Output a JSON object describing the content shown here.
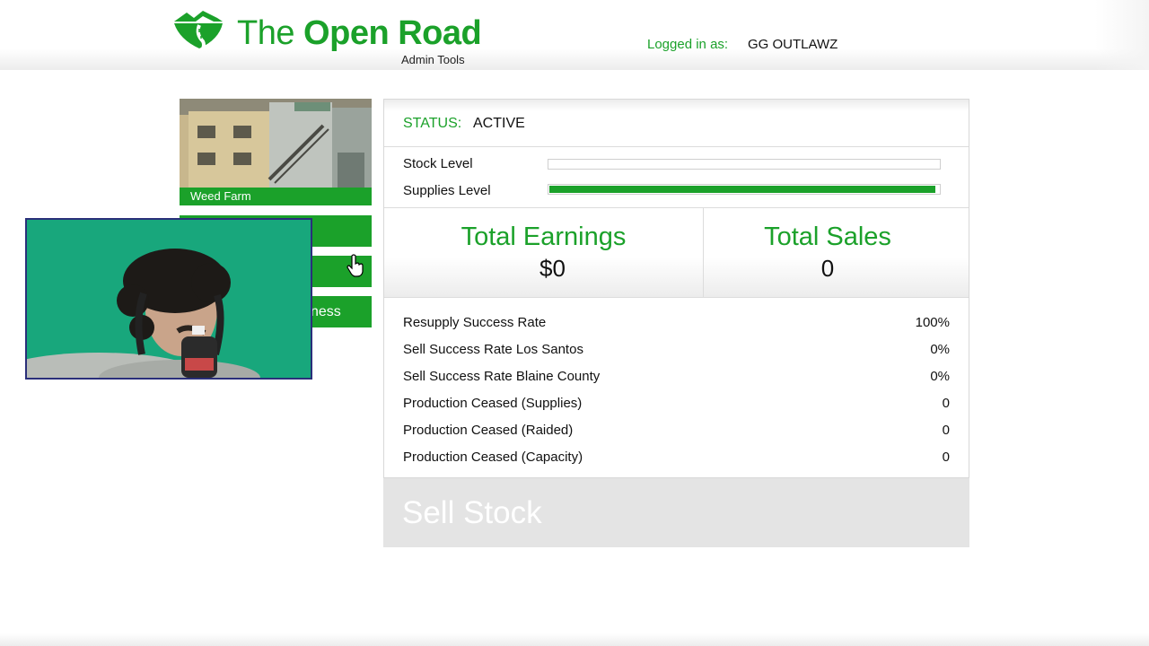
{
  "header": {
    "brand_title_plain": "The ",
    "brand_title_bold": "Open",
    "brand_title_end": " Road",
    "brand_subtitle": "Admin Tools",
    "login_label": "Logged in as:",
    "login_user": "GG OUTLAWZ"
  },
  "business": {
    "name": "Weed Farm",
    "buttons": [
      {
        "label": ""
      },
      {
        "label": ""
      },
      {
        "label": "ness"
      }
    ]
  },
  "status": {
    "label": "STATUS:",
    "value": "ACTIVE"
  },
  "levels": {
    "stock_label": "Stock Level",
    "stock_fraction": 0.0,
    "supplies_label": "Supplies Level",
    "supplies_fraction": 0.99
  },
  "totals": {
    "earnings_title": "Total Earnings",
    "earnings_value": "$0",
    "sales_title": "Total Sales",
    "sales_value": "0"
  },
  "stats": [
    {
      "label": "Resupply Success Rate",
      "value": "100%"
    },
    {
      "label": "Sell Success Rate Los Santos",
      "value": "0%"
    },
    {
      "label": "Sell Success Rate Blaine County",
      "value": "0%"
    },
    {
      "label": "Production Ceased (Supplies)",
      "value": "0"
    },
    {
      "label": "Production Ceased (Raided)",
      "value": "0"
    },
    {
      "label": "Production Ceased (Capacity)",
      "value": "0"
    }
  ],
  "sell_button": "Sell Stock",
  "colors": {
    "accent": "#1ba12a",
    "sell_button_bg": "#e4e4e4"
  }
}
